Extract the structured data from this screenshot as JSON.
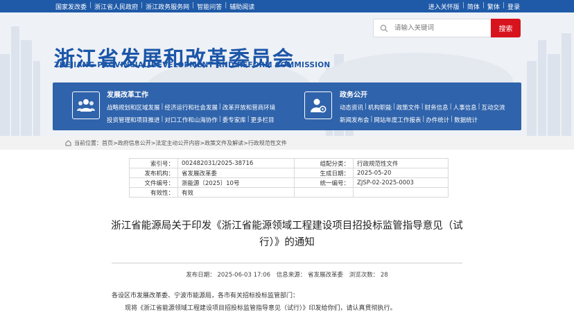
{
  "topbar": {
    "left_links": [
      "国家发改委",
      "浙江省人民政府",
      "浙江政务服务网",
      "智能问答",
      "辅助阅读"
    ],
    "right_links": [
      "进入关怀版",
      "简体",
      "繁体",
      "登录"
    ]
  },
  "header": {
    "title_cn": "浙江省发展和改革委员会",
    "title_en": "ZHEJIANG PROVINCIAL DEVELOPMENT AND REFORM COMMISSION"
  },
  "search": {
    "placeholder": "请输入关键词",
    "button": "搜索"
  },
  "nav": {
    "left": {
      "title": "发展改革工作",
      "row1": [
        "战略规划和区域发展",
        "经济运行和社会发展",
        "改革开放和营商环境"
      ],
      "row2": [
        "投资管理和项目推进",
        "对口工作和山海协作",
        "委专家库",
        "更多栏目"
      ]
    },
    "right": {
      "title": "政务公开",
      "row1": [
        "动态资讯",
        "机构职能",
        "政策文件",
        "财务信息",
        "人事信息",
        "互动交流"
      ],
      "row2": [
        "新闻发布会",
        "网站年度工作报表",
        "办件统计",
        "数据统计"
      ]
    }
  },
  "breadcrumb": {
    "prefix": "当前位置：",
    "items": [
      "首页",
      "政府信息公开",
      "法定主动公开内容",
      "政策文件及解读",
      "行政规范性文件"
    ]
  },
  "meta": {
    "index_label": "索引号：",
    "index_value": "002482031/2025-38716",
    "category_label": "组配分类：",
    "category_value": "行政规范性文件",
    "issuer_label": "发布机构：",
    "issuer_value": "省发展改革委",
    "created_label": "生成日期：",
    "created_value": "2025-05-20",
    "docno_label": "文件编号：",
    "docno_value": "浙能源〔2025〕10号",
    "unified_label": "统一编号：",
    "unified_value": "ZJSP-02-2025-0003",
    "validity_label": "有效性：",
    "validity_value": "有效"
  },
  "article": {
    "title": "浙江省能源局关于印发《浙江省能源领域工程建设项目招投标监管指导意见（试行）》的通知",
    "publish_date": "发布日期： 2025-06-03 17:06",
    "source": "信息来源： 省发展改革委",
    "views": "浏览次数： 28",
    "para1": "各设区市发展改革委、宁波市能源局，各市有关招标投标监管部门：",
    "para2": "现将《浙江省能源领域工程建设项目招投标监管指导意见（试行）》印发给你们，请认真贯彻执行。"
  }
}
